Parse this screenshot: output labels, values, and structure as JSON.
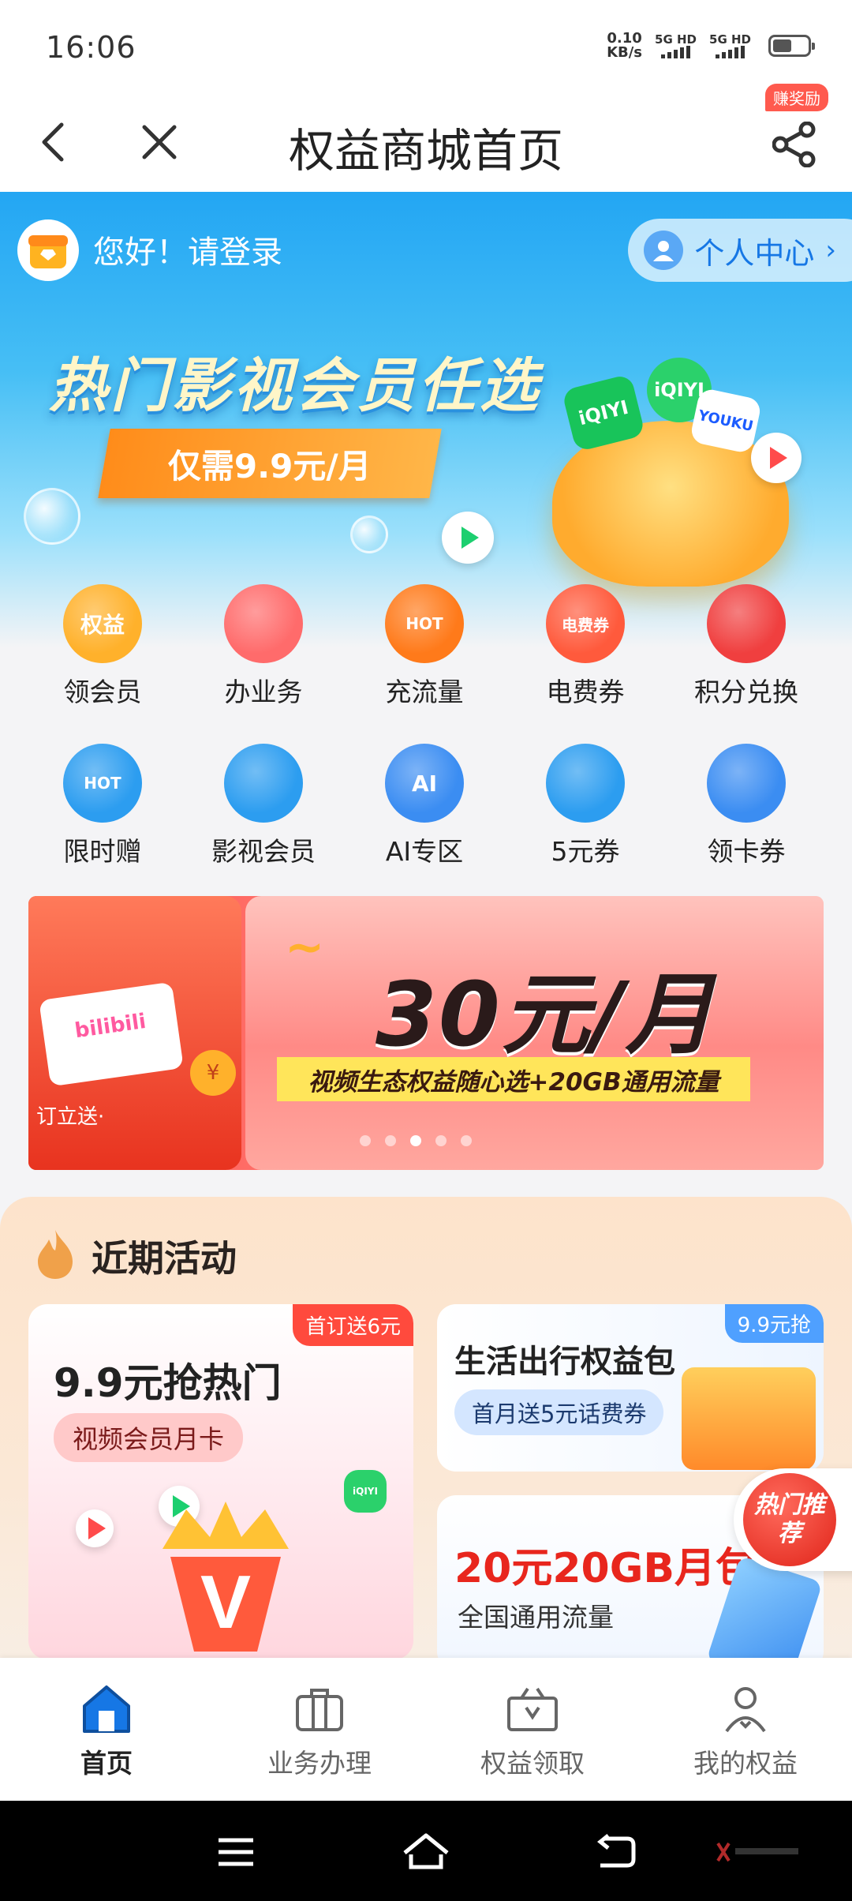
{
  "status_bar": {
    "time": "16:06",
    "net_speed_value": "0.10",
    "net_speed_unit": "KB/s",
    "sim1_label": "5G HD",
    "sim2_label": "5G HD",
    "battery_level": 0.55
  },
  "header": {
    "title": "权益商城首页",
    "reward_badge": "赚奖励",
    "back_icon": "chevron-left-icon",
    "close_icon": "close-icon",
    "share_icon": "share-icon"
  },
  "hero": {
    "greeting": "您好！请登录",
    "personal_center": "个人中心",
    "personal_center_chevron": "›",
    "banner_title": "热门影视会员任选",
    "banner_price": "仅需9.9元/月",
    "iqiyi_label": "iQIYI",
    "youku_label": "YOUKU"
  },
  "icon_grid": [
    {
      "label": "领会员",
      "icon_text": "权益",
      "color": "#ffb12b"
    },
    {
      "label": "办业务",
      "icon_text": "",
      "color": "#ff6b6b"
    },
    {
      "label": "充流量",
      "icon_text": "HOT",
      "color": "#ff7a1a"
    },
    {
      "label": "电费券",
      "icon_text": "电费券",
      "color": "#ff5a3c"
    },
    {
      "label": "积分兑换",
      "icon_text": "",
      "color": "#f03f3f"
    },
    {
      "label": "限时赠",
      "icon_text": "HOT",
      "color": "#2c9df0"
    },
    {
      "label": "影视会员",
      "icon_text": "",
      "color": "#2c9df0"
    },
    {
      "label": "AI专区",
      "icon_text": "AI",
      "color": "#3b8df2"
    },
    {
      "label": "5元券",
      "icon_text": "",
      "color": "#2c9df0"
    },
    {
      "label": "领卡券",
      "icon_text": "",
      "color": "#3b8df2"
    }
  ],
  "promo": {
    "title": "30元/月",
    "subtitle": "视频生态权益随心选+20GB通用流量",
    "left_tag": "订立送·",
    "left_brand": "bilibili",
    "coin_symbol": "¥",
    "active_slide": 2,
    "slide_count": 5
  },
  "activity": {
    "title": "近期活动",
    "card_a": {
      "badge": "首订送6元",
      "title": "9.9元抢热门",
      "pill": "视频会员月卡",
      "crown_letter": "V"
    },
    "card_b": {
      "badge": "9.9元抢",
      "title": "生活出行权益包",
      "pill": "首月送5元话费券"
    },
    "card_c": {
      "title": "20元20GB月包",
      "subtitle": "全国通用流量"
    },
    "hot_recommend": "热门推荐"
  },
  "tab_bar": [
    {
      "label": "首页",
      "icon": "home-icon",
      "active": true
    },
    {
      "label": "业务办理",
      "icon": "briefcase-icon",
      "active": false
    },
    {
      "label": "权益领取",
      "icon": "gift-box-icon",
      "active": false
    },
    {
      "label": "我的权益",
      "icon": "user-icon",
      "active": false
    }
  ],
  "colors": {
    "accent": "#1677e5",
    "hot_red": "#e8261d",
    "hero_blue": "#23a6f3"
  }
}
